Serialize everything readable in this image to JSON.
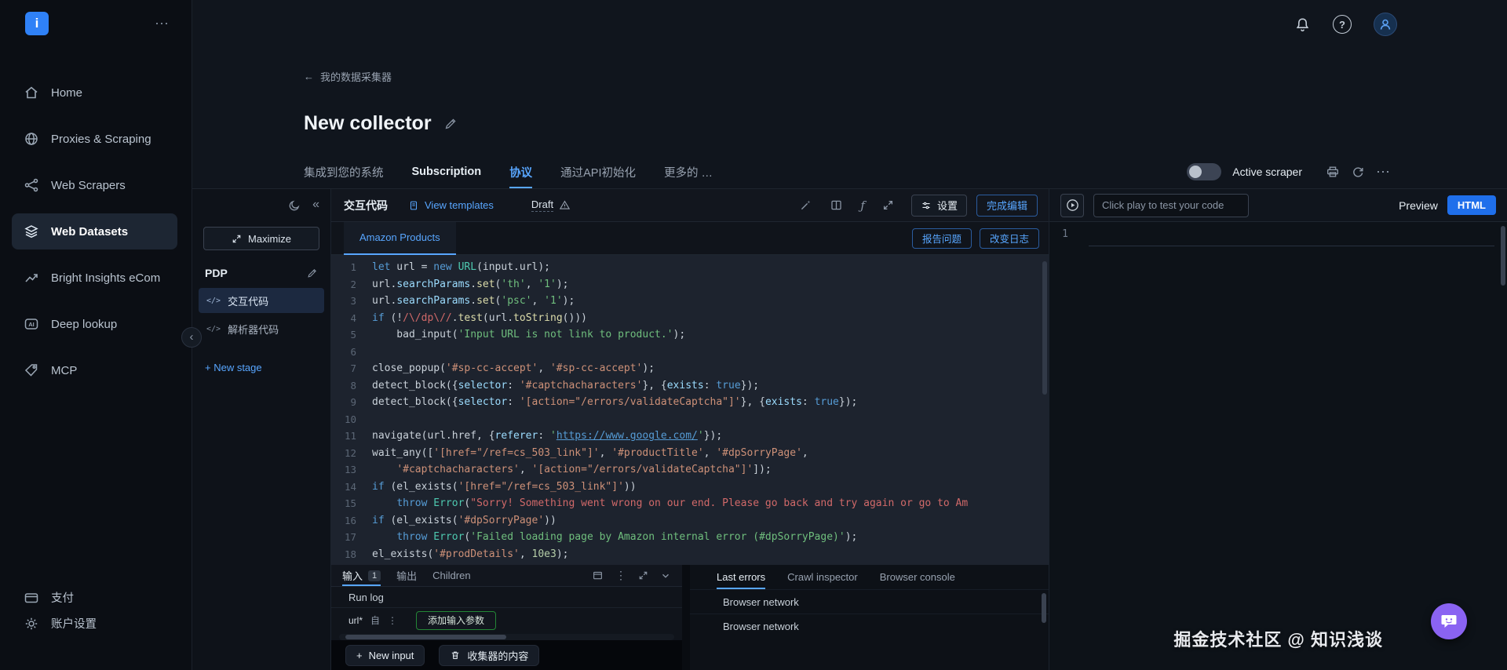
{
  "icons": {
    "ellipsis_h": "⋯",
    "ellipsis_v": "⋮",
    "collapse_double": "«",
    "chevron_left": "‹",
    "fx": "ƒ",
    "back_arrow": "←",
    "code_glyph": "</>",
    "question_mark": "?",
    "plus": "+"
  },
  "colors": {
    "accent_blue": "#58a6ff",
    "primary_button_blue": "#1f6feb",
    "logo_blue": "#2f81f7",
    "code_background": "#1d232e",
    "green_button_border": "#238636"
  },
  "sidebar": {
    "logo_letter": "i",
    "items": [
      {
        "label": "Home"
      },
      {
        "label": "Proxies & Scraping"
      },
      {
        "label": "Web Scrapers"
      },
      {
        "label": "Web Datasets"
      },
      {
        "label": "Bright Insights eCom"
      },
      {
        "label": "Deep lookup"
      },
      {
        "label": "MCP"
      }
    ],
    "bottom_items": [
      {
        "label": "支付"
      },
      {
        "label": "账户设置"
      }
    ]
  },
  "header": {
    "breadcrumb": "我的数据采集器",
    "title": "New collector",
    "tabs": [
      {
        "label": "集成到您的系统"
      },
      {
        "label": "Subscription"
      },
      {
        "label": "协议"
      },
      {
        "label": "通过API初始化"
      },
      {
        "label": "更多的 …"
      }
    ],
    "active_scraper_label": "Active scraper"
  },
  "stage": {
    "maximize_label": "Maximize",
    "stage_name": "PDP",
    "items": [
      {
        "label": "交互代码"
      },
      {
        "label": "解析器代码"
      }
    ],
    "new_stage_label": "+ New stage"
  },
  "editor": {
    "title": "交互代码",
    "view_templates_label": "View templates",
    "draft_label": "Draft",
    "settings_label": "设置",
    "finish_label": "完成编辑",
    "tab_label": "Amazon Products",
    "report_label": "报告问题",
    "changelog_label": "改变日志",
    "code_lines": [
      [
        [
          "kw",
          "let"
        ],
        [
          "pl",
          " url = "
        ],
        [
          "kw",
          "new"
        ],
        [
          "cls",
          " URL"
        ],
        [
          "pl",
          "(input.url);"
        ]
      ],
      [
        [
          "pl",
          "url."
        ],
        [
          "prop",
          "searchParams"
        ],
        [
          "pl",
          "."
        ],
        [
          "meth",
          "set"
        ],
        [
          "pl",
          "("
        ],
        [
          "s-g",
          "'th'"
        ],
        [
          "pl",
          ", "
        ],
        [
          "s-g",
          "'1'"
        ],
        [
          "pl",
          ");"
        ]
      ],
      [
        [
          "pl",
          "url."
        ],
        [
          "prop",
          "searchParams"
        ],
        [
          "pl",
          "."
        ],
        [
          "meth",
          "set"
        ],
        [
          "pl",
          "("
        ],
        [
          "s-g",
          "'psc'"
        ],
        [
          "pl",
          ", "
        ],
        [
          "s-g",
          "'1'"
        ],
        [
          "pl",
          ");"
        ]
      ],
      [
        [
          "kw",
          "if"
        ],
        [
          "pl",
          " (!"
        ],
        [
          "rex",
          "/\\/dp\\//"
        ],
        [
          "pl",
          "."
        ],
        [
          "meth",
          "test"
        ],
        [
          "pl",
          "(url."
        ],
        [
          "meth",
          "toString"
        ],
        [
          "pl",
          "()))"
        ]
      ],
      [
        [
          "pl",
          "    bad_input("
        ],
        [
          "s-g",
          "'Input URL is not link to product.'"
        ],
        [
          "pl",
          ");"
        ]
      ],
      [],
      [
        [
          "pl",
          "close_popup("
        ],
        [
          "s-o",
          "'#sp-cc-accept'"
        ],
        [
          "pl",
          ", "
        ],
        [
          "s-o",
          "'#sp-cc-accept'"
        ],
        [
          "pl",
          ");"
        ]
      ],
      [
        [
          "pl",
          "detect_block({"
        ],
        [
          "prop",
          "selector"
        ],
        [
          "pl",
          ": "
        ],
        [
          "s-o",
          "'#captchacharacters'"
        ],
        [
          "pl",
          "}, {"
        ],
        [
          "prop",
          "exists"
        ],
        [
          "pl",
          ": "
        ],
        [
          "kw",
          "true"
        ],
        [
          "pl",
          "});"
        ]
      ],
      [
        [
          "pl",
          "detect_block({"
        ],
        [
          "prop",
          "selector"
        ],
        [
          "pl",
          ": "
        ],
        [
          "s-o",
          "'[action=\"/errors/validateCaptcha\"]'"
        ],
        [
          "pl",
          "}, {"
        ],
        [
          "prop",
          "exists"
        ],
        [
          "pl",
          ": "
        ],
        [
          "kw",
          "true"
        ],
        [
          "pl",
          "});"
        ]
      ],
      [],
      [
        [
          "pl",
          "navigate(url.href, {"
        ],
        [
          "prop",
          "referer"
        ],
        [
          "pl",
          ": "
        ],
        [
          "s-g",
          "'"
        ],
        [
          "lnk",
          "https://www.google.com/"
        ],
        [
          "s-g",
          "'"
        ],
        [
          "pl",
          "});"
        ]
      ],
      [
        [
          "pl",
          "wait_any(["
        ],
        [
          "s-o",
          "'[href=\"/ref=cs_503_link\"]'"
        ],
        [
          "pl",
          ", "
        ],
        [
          "s-o",
          "'#productTitle'"
        ],
        [
          "pl",
          ", "
        ],
        [
          "s-o",
          "'#dpSorryPage'"
        ],
        [
          "pl",
          ","
        ]
      ],
      [
        [
          "pl",
          "    "
        ],
        [
          "s-o",
          "'#captchacharacters'"
        ],
        [
          "pl",
          ", "
        ],
        [
          "s-o",
          "'[action=\"/errors/validateCaptcha\"]'"
        ],
        [
          "pl",
          "]);"
        ]
      ],
      [
        [
          "kw",
          "if"
        ],
        [
          "pl",
          " (el_exists("
        ],
        [
          "s-o",
          "'[href=\"/ref=cs_503_link\"]'"
        ],
        [
          "pl",
          "))"
        ]
      ],
      [
        [
          "pl",
          "    "
        ],
        [
          "kw",
          "throw"
        ],
        [
          "pl",
          " "
        ],
        [
          "cls",
          "Error"
        ],
        [
          "pl",
          "("
        ],
        [
          "s-r",
          "\"Sorry! Something went wrong on our end. Please go back and try again or go to Am"
        ]
      ],
      [
        [
          "kw",
          "if"
        ],
        [
          "pl",
          " (el_exists("
        ],
        [
          "s-o",
          "'#dpSorryPage'"
        ],
        [
          "pl",
          "))"
        ]
      ],
      [
        [
          "pl",
          "    "
        ],
        [
          "kw",
          "throw"
        ],
        [
          "pl",
          " "
        ],
        [
          "cls",
          "Error"
        ],
        [
          "pl",
          "("
        ],
        [
          "s-g",
          "'Failed loading page by Amazon internal error (#dpSorryPage)'"
        ],
        [
          "pl",
          ");"
        ]
      ],
      [
        [
          "pl",
          "el_exists("
        ],
        [
          "s-o",
          "'#prodDetails'"
        ],
        [
          "pl",
          ", "
        ],
        [
          "num",
          "10e3"
        ],
        [
          "pl",
          ");"
        ]
      ]
    ]
  },
  "console_left": {
    "tabs": [
      {
        "label": "输入",
        "badge": "1"
      },
      {
        "label": "输出"
      },
      {
        "label": "Children"
      }
    ],
    "run_log_label": "Run log",
    "param_row": {
      "name": "url*",
      "type": "自"
    },
    "add_param_label": "添加输入参数",
    "new_input_label": "New input",
    "collector_content_label": "收集器的内容"
  },
  "console_right": {
    "tabs": [
      {
        "label": "Last errors"
      },
      {
        "label": "Crawl inspector"
      },
      {
        "label": "Browser console"
      }
    ],
    "rows": [
      "Browser network",
      "Browser network"
    ]
  },
  "preview": {
    "placeholder": "Click play to test your code",
    "preview_label": "Preview",
    "html_label": "HTML",
    "line_number": "1"
  },
  "watermark": "掘金技术社区 @ 知识浅谈"
}
